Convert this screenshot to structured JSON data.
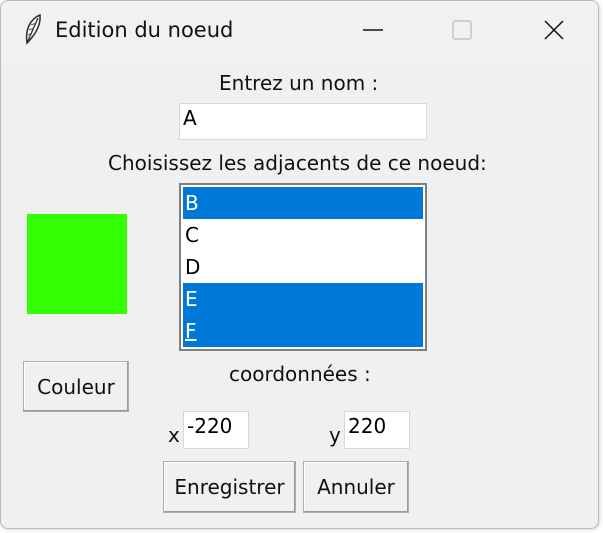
{
  "window": {
    "title": "Edition du noeud",
    "app_icon": "feather-icon",
    "controls": [
      "minimize-icon",
      "maximize-icon",
      "close-icon"
    ]
  },
  "form": {
    "name_label": "Entrez un nom :",
    "name_value": "A",
    "adjacent_label": "Choisissez les adjacents de ce noeud:",
    "adjacent_options": [
      {
        "label": "B",
        "selected": true
      },
      {
        "label": "C",
        "selected": false
      },
      {
        "label": "D",
        "selected": false
      },
      {
        "label": "E",
        "selected": true
      },
      {
        "label": "F",
        "selected": true
      }
    ],
    "color_value": "#33ff00",
    "color_button": "Couleur",
    "coords_label": "coordonnées :",
    "x_label": "x",
    "x_value": "-220",
    "y_label": "y",
    "y_value": "220",
    "save_button": "Enregistrer",
    "cancel_button": "Annuler"
  },
  "colors": {
    "selection": "#0078d7",
    "window_bg": "#f0f0f0",
    "titlebar_bg": "#f3f0f4"
  }
}
